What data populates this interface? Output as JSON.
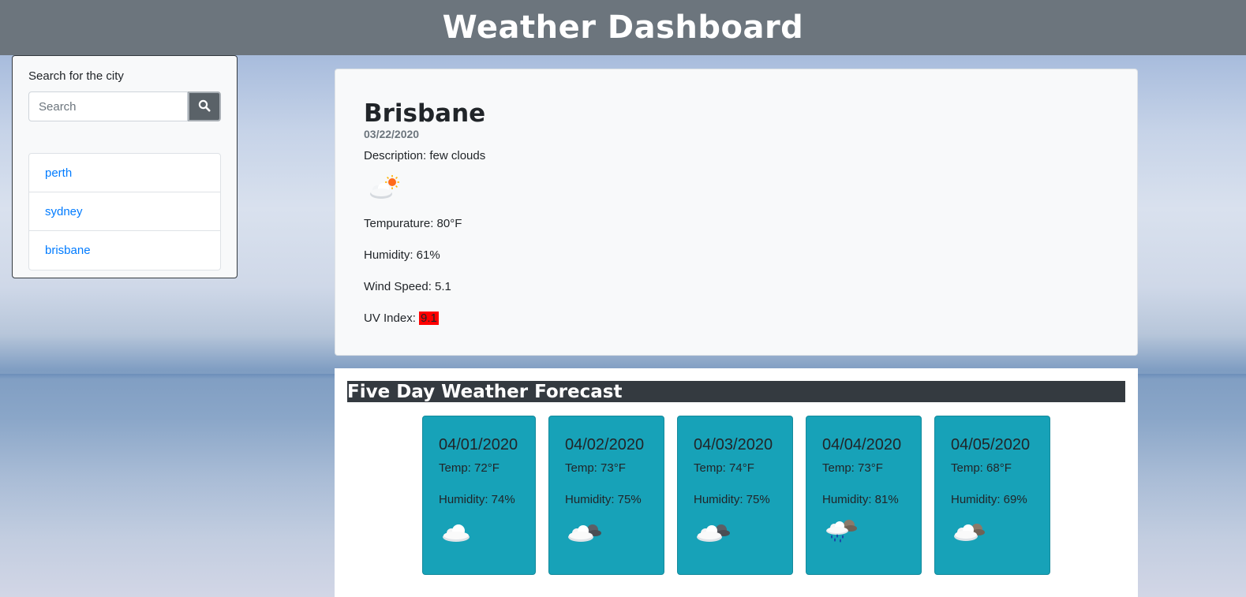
{
  "app": {
    "title": "Weather Dashboard"
  },
  "search": {
    "label": "Search for the city",
    "placeholder": "Search",
    "button_icon": "search-icon"
  },
  "history": [
    "perth",
    "sydney",
    "brisbane"
  ],
  "current": {
    "city": "Brisbane",
    "date": "03/22/2020",
    "description": "Description: few clouds",
    "icon": "few-clouds-day-icon",
    "temperature": "Tempurature: 80°F",
    "humidity": "Humidity: 61%",
    "wind": "Wind Speed: 5.1",
    "uv_label": "UV Index: ",
    "uv_value": "9.1",
    "uv_color": "#ff0000"
  },
  "forecast": {
    "title": "Five Day Weather Forecast",
    "days": [
      {
        "date": "04/01/2020",
        "temp": "Temp: 72°F",
        "humidity": "Humidity: 74%",
        "icon": "cloud-icon"
      },
      {
        "date": "04/02/2020",
        "temp": "Temp: 73°F",
        "humidity": "Humidity: 75%",
        "icon": "broken-clouds-icon"
      },
      {
        "date": "04/03/2020",
        "temp": "Temp: 74°F",
        "humidity": "Humidity: 75%",
        "icon": "broken-clouds-icon"
      },
      {
        "date": "04/04/2020",
        "temp": "Temp: 73°F",
        "humidity": "Humidity: 81%",
        "icon": "rain-icon"
      },
      {
        "date": "04/05/2020",
        "temp": "Temp: 68°F",
        "humidity": "Humidity: 69%",
        "icon": "broken-clouds-icon"
      }
    ]
  },
  "colors": {
    "header_bg": "#6c757d",
    "forecast_card_bg": "#17a2b8",
    "forecast_title_bg": "#343a40",
    "link": "#007bff"
  }
}
